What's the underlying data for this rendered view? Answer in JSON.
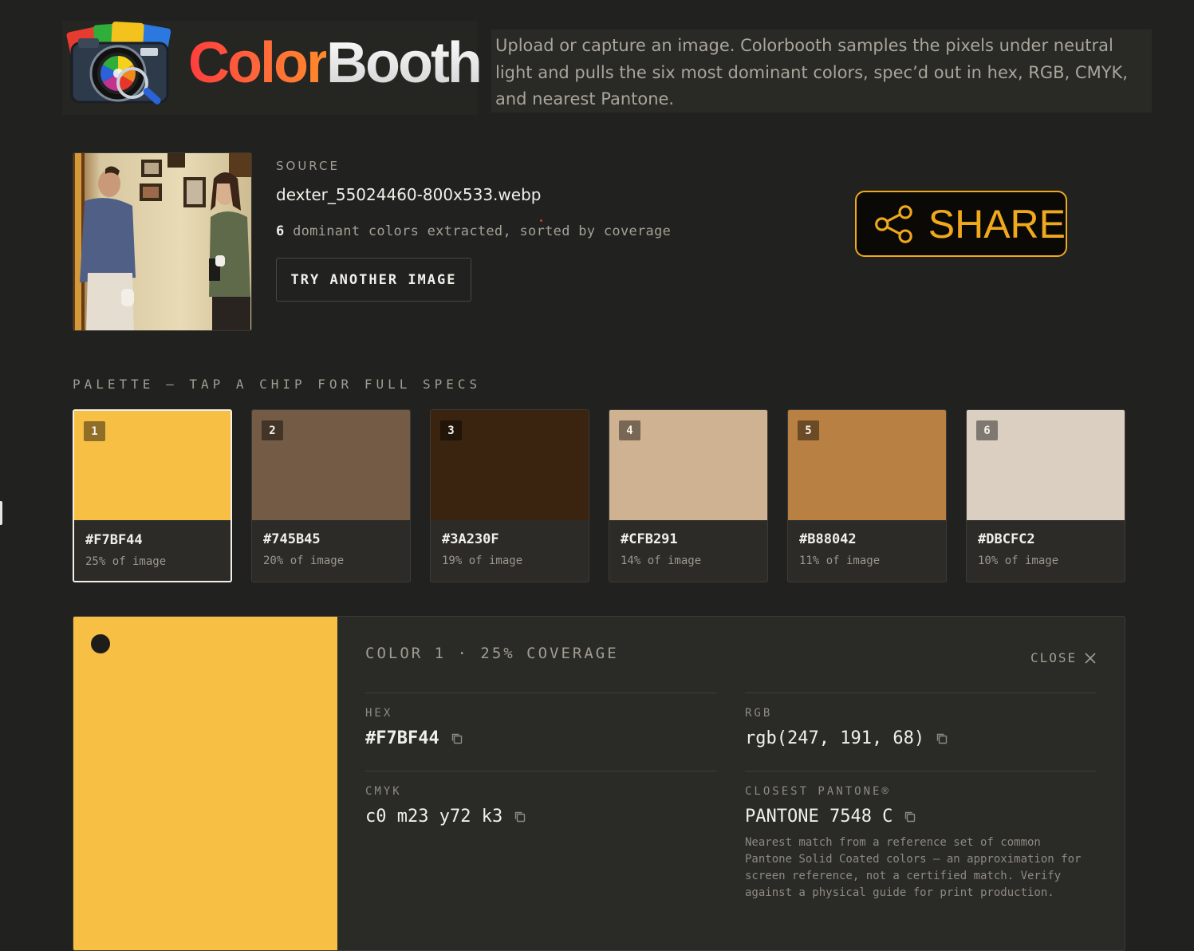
{
  "brand": {
    "name_part1": "Color",
    "name_part2": "Booth",
    "tagline": "Upload or capture an image. Colorbooth samples the pixels under neutral light and pulls the six most dominant colors, spec’d out in hex, RGB, CMYK, and nearest Pantone."
  },
  "source": {
    "label": "SOURCE",
    "filename": "dexter_55024460-800x533.webp",
    "count": "6",
    "summary": " dominant colors extracted, sorted by coverage",
    "try_button": "TRY ANOTHER IMAGE",
    "share_button": "SHARE"
  },
  "palette": {
    "heading": "PALETTE — TAP A CHIP FOR FULL SPECS",
    "chips": [
      {
        "num": "1",
        "hex": "#F7BF44",
        "pct": "25% of image",
        "color": "#F7BF44"
      },
      {
        "num": "2",
        "hex": "#745B45",
        "pct": "20% of image",
        "color": "#745B45"
      },
      {
        "num": "3",
        "hex": "#3A230F",
        "pct": "19% of image",
        "color": "#3A230F"
      },
      {
        "num": "4",
        "hex": "#CFB291",
        "pct": "14% of image",
        "color": "#CFB291"
      },
      {
        "num": "5",
        "hex": "#B88042",
        "pct": "11% of image",
        "color": "#B88042"
      },
      {
        "num": "6",
        "hex": "#DBCFC2",
        "pct": "10% of image",
        "color": "#DBCFC2"
      }
    ]
  },
  "detail": {
    "title": "COLOR 1 · 25% COVERAGE",
    "close": "CLOSE",
    "color": "#F7BF44",
    "hex_label": "HEX",
    "hex_value": "#F7BF44",
    "rgb_label": "RGB",
    "rgb_value": "rgb(247, 191, 68)",
    "cmyk_label": "CMYK",
    "cmyk_value": "c0 m23 y72 k3",
    "pantone_label": "CLOSEST PANTONE®",
    "pantone_value": "PANTONE 7548 C",
    "pantone_note": "Nearest match from a reference set of common Pantone Solid Coated colors — an approximation for screen reference, not a certified match. Verify against a physical guide for print production."
  },
  "colors": {
    "accent": "#F0A81C",
    "background": "#21211F"
  }
}
